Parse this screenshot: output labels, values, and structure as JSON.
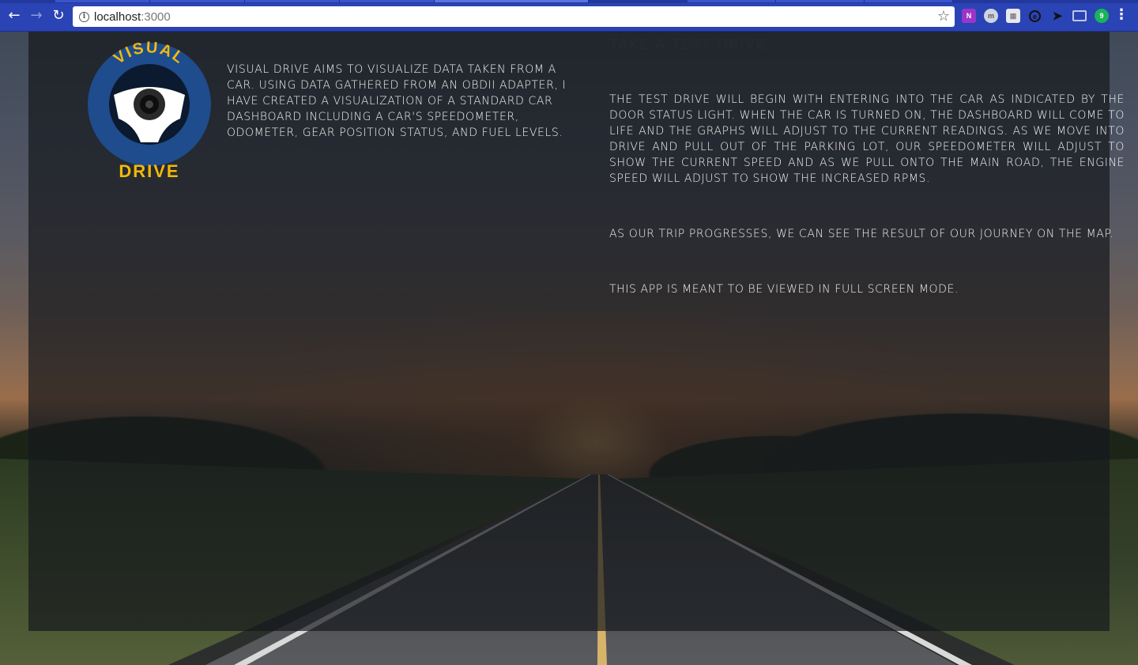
{
  "browser": {
    "url_host": "localhost",
    "url_port": ":3000",
    "extensions": [
      "N",
      "m",
      "",
      "e",
      "",
      "",
      "9"
    ]
  },
  "logo": {
    "top_text": "VISUAL",
    "bottom_text": "DRIVE"
  },
  "intro": {
    "text": "Visual Drive aims to visualize data taken from a car. Using data gathered from an OBDII adapter, I have created a visualization of a standard car dashboard including a car's speedometer, odometer, gear position status, and fuel levels."
  },
  "test_drive": {
    "title": "Take a test drive",
    "paragraphs": [
      "The test drive will begin with entering into the car as indicated by the door status light. When the car is turned on, the dashboard will come to life and the graphs will adjust to the current readings. As we move into drive and pull out of the parking lot, our speedometer will adjust to show the current speed and as we pull onto the main road, the engine speed will adjust to show the increased RPMs.",
      "As our trip progresses, we can see the result of our journey on the map.",
      "This app is meant to be viewed in full screen mode."
    ]
  },
  "colors": {
    "chrome": "#2a43b5",
    "logo_blue": "#1e4c8c",
    "logo_gold": "#f2b90c",
    "text": "#f2f2f2",
    "title": "#262a31"
  }
}
